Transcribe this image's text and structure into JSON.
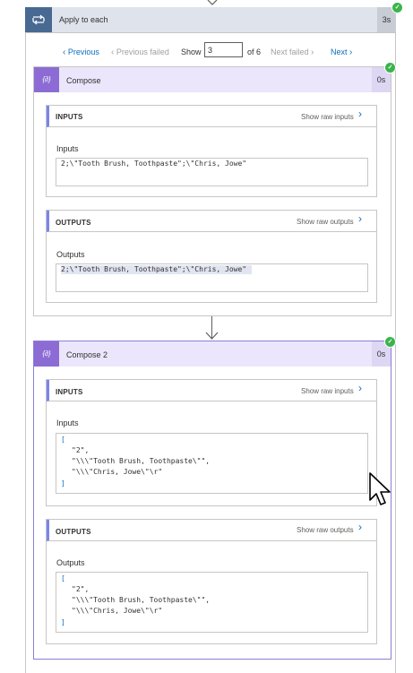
{
  "apply_to_each": {
    "title": "Apply to each",
    "duration": "3s",
    "icon": "loop-icon"
  },
  "pager": {
    "previous": "Previous",
    "previous_failed": "Previous failed",
    "show": "Show",
    "value": "3",
    "of": "of 6",
    "next_failed": "Next failed",
    "next": "Next"
  },
  "compose1": {
    "title": "Compose",
    "duration": "0s",
    "inputs": {
      "header": "INPUTS",
      "raw_link": "Show raw inputs",
      "label": "Inputs",
      "value": "2;\\\"Tooth Brush, Toothpaste\";\\\"Chris, Jowe\""
    },
    "outputs": {
      "header": "OUTPUTS",
      "raw_link": "Show raw outputs",
      "label": "Outputs",
      "value": "2;\\\"Tooth Brush, Toothpaste\";\\\"Chris, Jowe\""
    }
  },
  "compose2": {
    "title": "Compose 2",
    "duration": "0s",
    "inputs": {
      "header": "INPUTS",
      "raw_link": "Show raw inputs",
      "label": "Inputs",
      "open": "[",
      "lines": [
        "\"2\",",
        "\"\\\\\\\"Tooth Brush, Toothpaste\\\"\",",
        "\"\\\\\\\"Chris, Jowe\\\"\\r\""
      ],
      "close": "]"
    },
    "outputs": {
      "header": "OUTPUTS",
      "raw_link": "Show raw outputs",
      "label": "Outputs",
      "open": "[",
      "lines": [
        "\"2\",",
        "\"\\\\\\\"Tooth Brush, Toothpaste\\\"\",",
        "\"\\\\\\\"Chris, Jowe\\\"\\r\""
      ],
      "close": "]"
    }
  },
  "colors": {
    "accent": "#0f6cbd",
    "compose_accent": "#8c6cd4",
    "loop_header": "#486991",
    "success": "#3bb44a"
  }
}
